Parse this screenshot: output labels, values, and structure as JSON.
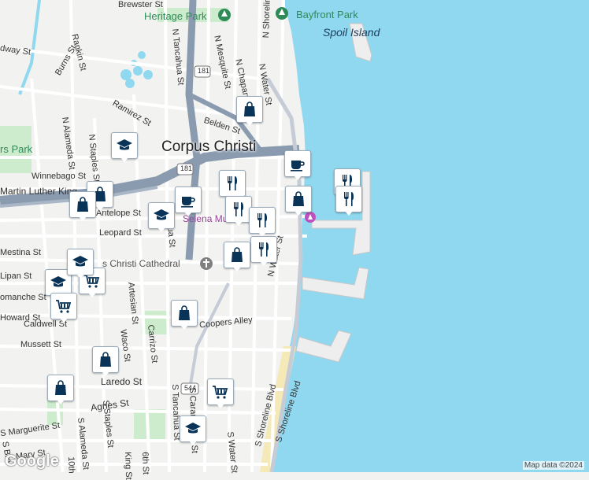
{
  "map": {
    "city_label": "Corpus Christi",
    "water_label": "Spoil Island",
    "parks": [
      "Heritage Park",
      "Bayfront Park",
      "rs Park"
    ],
    "landmarks": [
      "Selena Museum",
      "s Christi Cathedral"
    ],
    "credit": "Map data ©2024",
    "logo": "Google",
    "colors": {
      "water": "#8fd8ef",
      "land": "#f2f2f0",
      "park": "#cdeccd",
      "highway": "#8a9bb0",
      "road": "#ffffff",
      "beach": "#f6e9b8",
      "pin_icon": "#0a3358"
    }
  },
  "streets": {
    "brewster": "Brewster St",
    "rankin": "Rankin St",
    "dway": "dway St",
    "burns": "Burns St",
    "ramirez": "Ramirez St",
    "tancahua_n": "N Tancahua St",
    "mesquite_n": "N Mesquite St",
    "chaparral_n": "N Chaparral St",
    "water_n": "N Water St",
    "shoreline_n": "N Shoreline Blvd",
    "belden": "Belden St",
    "alameda_n": "N Alameda St",
    "staples_n": "N Staples St",
    "winnebago": "Winnebago St",
    "mlk": "Martin Luther King",
    "antelope": "Antelope St",
    "leopard": "Leopard St",
    "mestina": "Mestina St",
    "lipan": "Lipan St",
    "comanche": "omanche St",
    "howard": "Howard St",
    "caldwell": "Caldwell St",
    "mussett": "Mussett St",
    "artesian": "Artesian St",
    "carrizo": "Carrizo St",
    "waco": "Waco St",
    "coopers": "Coopers Alley",
    "laredo": "Laredo St",
    "agnes": "Agnes St",
    "marguerite": "S Marguerite St",
    "mary": "Mary St",
    "staples_s": "S Staples St",
    "alameda_s": "S Alameda St",
    "tancahua_s": "S Tancahua St",
    "carancahua_s": "S Carancahua St",
    "water_s": "S Water St",
    "shoreline_s": "S Shoreline Blvd",
    "shoreline_s2": "S Shoreline Blvd",
    "water_n2": "N Water St",
    "king": "King St",
    "sixth": "6th St",
    "tenth": "10th",
    "brow": "S Bro",
    "ua": "ua St",
    "hwy181a": "181",
    "hwy181b": "181",
    "hwy544": "544"
  },
  "pois": [
    {
      "name": "shopping-bag-icon",
      "id": "p1"
    },
    {
      "name": "school-icon",
      "id": "p2"
    },
    {
      "name": "shopping-bag-icon",
      "id": "p3"
    },
    {
      "name": "shopping-bag-icon",
      "id": "p4"
    },
    {
      "name": "coffee-icon",
      "id": "p5"
    },
    {
      "name": "school-icon",
      "id": "p6"
    },
    {
      "name": "restaurant-icon",
      "id": "p7"
    },
    {
      "name": "coffee-icon",
      "id": "p8"
    },
    {
      "name": "restaurant-icon",
      "id": "p9"
    },
    {
      "name": "restaurant-icon",
      "id": "p10"
    },
    {
      "name": "shopping-bag-icon",
      "id": "p11"
    },
    {
      "name": "restaurant-icon",
      "id": "p12"
    },
    {
      "name": "restaurant-icon",
      "id": "p13"
    },
    {
      "name": "restaurant-icon",
      "id": "p14"
    },
    {
      "name": "shopping-bag-icon",
      "id": "p15"
    },
    {
      "name": "school-icon",
      "id": "p16"
    },
    {
      "name": "grocery-cart-icon",
      "id": "p17"
    },
    {
      "name": "school-icon",
      "id": "p18"
    },
    {
      "name": "grocery-cart-icon",
      "id": "p19"
    },
    {
      "name": "shopping-bag-icon",
      "id": "p20"
    },
    {
      "name": "shopping-bag-icon",
      "id": "p21"
    },
    {
      "name": "shopping-bag-icon",
      "id": "p22"
    },
    {
      "name": "grocery-cart-icon",
      "id": "p23"
    },
    {
      "name": "school-icon",
      "id": "p24"
    }
  ]
}
